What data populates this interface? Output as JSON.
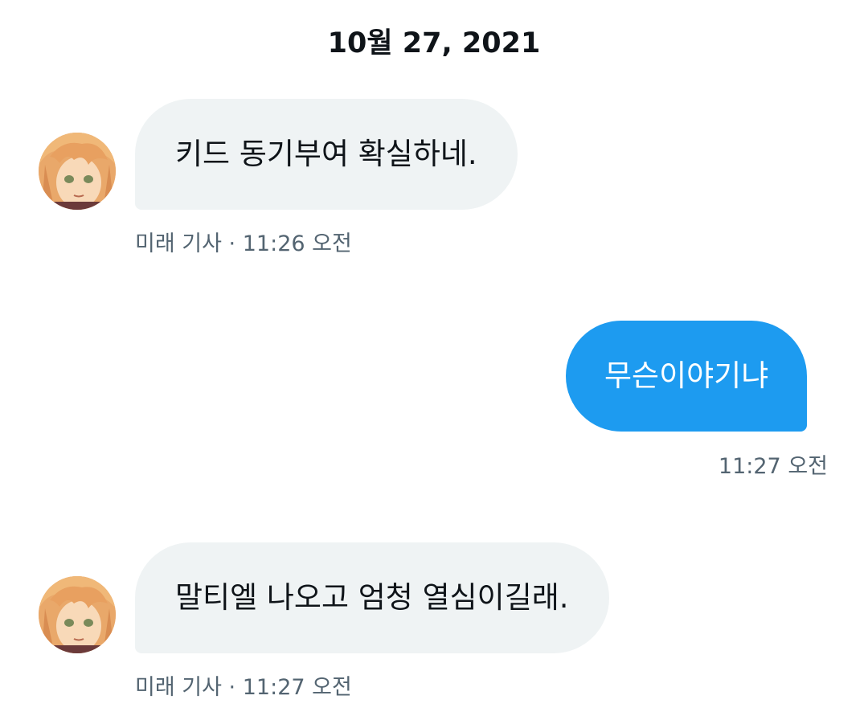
{
  "conversation": {
    "date_divider": "10월 27, 2021",
    "messages": [
      {
        "direction": "received",
        "text": "키드 동기부여 확실하네.",
        "sender": "미래 기사",
        "separator": "·",
        "time": "11:26 오전"
      },
      {
        "direction": "sent",
        "text": "무슨이야기냐",
        "time": "11:27 오전"
      },
      {
        "direction": "received",
        "text": "말티엘 나오고 엄청 열심이길래.",
        "sender": "미래 기사",
        "separator": "·",
        "time": "11:27 오전"
      }
    ]
  },
  "colors": {
    "sent_bubble": "#1d9bf0",
    "received_bubble": "#eff3f4",
    "meta_text": "#536471",
    "primary_text": "#0f1419"
  },
  "icons": {
    "avatar": "anime-character-avatar"
  }
}
